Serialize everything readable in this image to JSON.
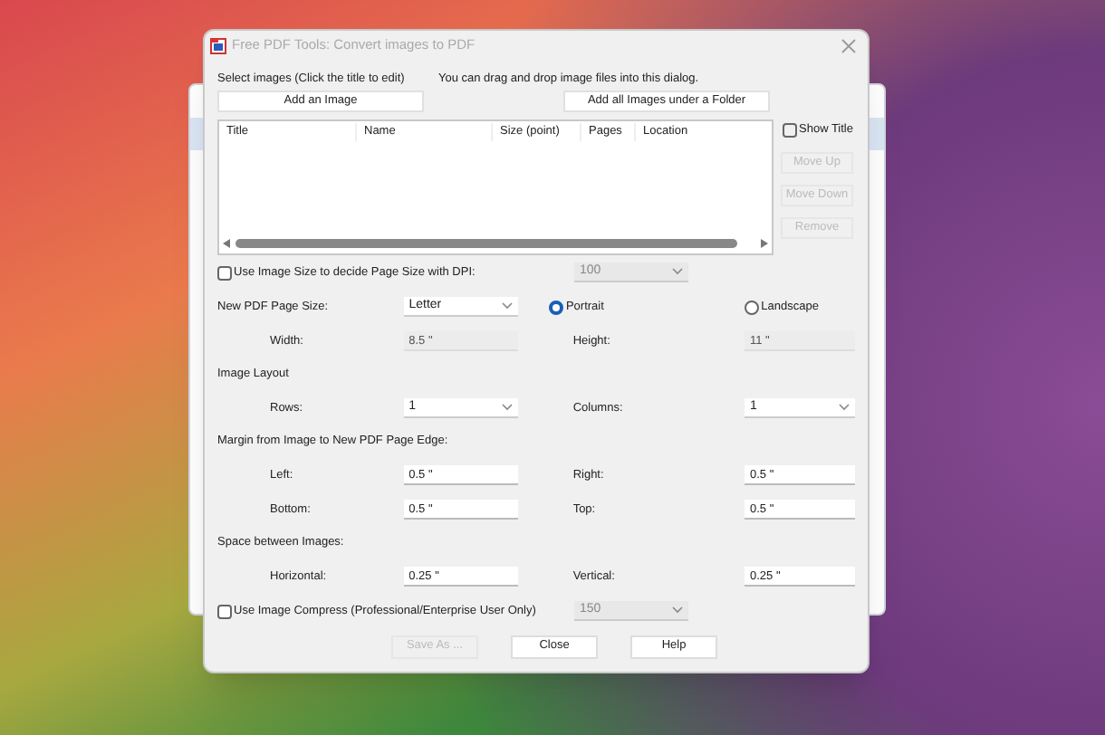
{
  "window": {
    "title": "Free PDF Tools: Convert images to PDF"
  },
  "instructions": [
    "Select images (Click the title to edit)",
    "You can drag and drop image files into this dialog."
  ],
  "top_buttons": [
    "Add an Image",
    "Add all Images under a Folder"
  ],
  "image_list": {
    "columns": [
      "Title",
      "Name",
      "Size (point)",
      "Pages",
      "Location"
    ]
  },
  "show_title": {
    "label": "Show Title",
    "checked": false
  },
  "side_buttons": [
    {
      "label": "Move Up",
      "disabled": true
    },
    {
      "label": "Move Down",
      "disabled": true
    },
    {
      "label": "Remove",
      "disabled": true
    }
  ],
  "rows": [
    {
      "kind": "check",
      "label": "Use Image Size to decide Page Size with DPI:",
      "checked": false,
      "dropdown": {
        "value": "100",
        "disabled": true
      }
    },
    {
      "kind": "form",
      "items": [
        {
          "kind": "label",
          "text": "New PDF Page Size:"
        },
        {
          "kind": "dropdown",
          "value": "Letter"
        },
        {
          "kind": "radio",
          "text": "Portrait",
          "selected": true
        },
        {
          "kind": "radio",
          "text": "Landscape",
          "selected": false
        }
      ]
    },
    {
      "kind": "form",
      "items": [
        {
          "kind": "sublabel",
          "text": "Width:"
        },
        {
          "kind": "readonly",
          "value": "8.5 \""
        },
        {
          "kind": "label",
          "text": "Height:"
        },
        {
          "kind": "readonly",
          "value": "11 \""
        }
      ]
    },
    {
      "kind": "section",
      "text": "Image Layout"
    },
    {
      "kind": "form",
      "items": [
        {
          "kind": "sublabel",
          "text": "Rows:"
        },
        {
          "kind": "dropdown",
          "value": "1"
        },
        {
          "kind": "label",
          "text": "Columns:"
        },
        {
          "kind": "dropdown",
          "value": "1"
        }
      ]
    },
    {
      "kind": "section",
      "text": "Margin from Image to New PDF Page Edge:"
    },
    {
      "kind": "form",
      "items": [
        {
          "kind": "sublabel",
          "text": "Left:"
        },
        {
          "kind": "input",
          "value": "0.5 \""
        },
        {
          "kind": "label",
          "text": "Right:"
        },
        {
          "kind": "input",
          "value": "0.5 \""
        }
      ]
    },
    {
      "kind": "form",
      "items": [
        {
          "kind": "sublabel",
          "text": "Bottom:"
        },
        {
          "kind": "input",
          "value": "0.5 \""
        },
        {
          "kind": "label",
          "text": "Top:"
        },
        {
          "kind": "input",
          "value": "0.5 \""
        }
      ]
    },
    {
      "kind": "section",
      "text": "Space between Images:"
    },
    {
      "kind": "form",
      "items": [
        {
          "kind": "sublabel",
          "text": "Horizontal:"
        },
        {
          "kind": "input",
          "value": "0.25 \""
        },
        {
          "kind": "label",
          "text": "Vertical:"
        },
        {
          "kind": "input",
          "value": "0.25 \""
        }
      ]
    },
    {
      "kind": "check",
      "label": "Use Image Compress  (Professional/Enterprise User Only)",
      "checked": false,
      "dropdown": {
        "value": "150",
        "disabled": true
      }
    }
  ],
  "bottom_buttons": [
    {
      "label": "Save As ...",
      "disabled": true
    },
    {
      "label": "Close",
      "disabled": false
    },
    {
      "label": "Help",
      "disabled": false
    }
  ]
}
